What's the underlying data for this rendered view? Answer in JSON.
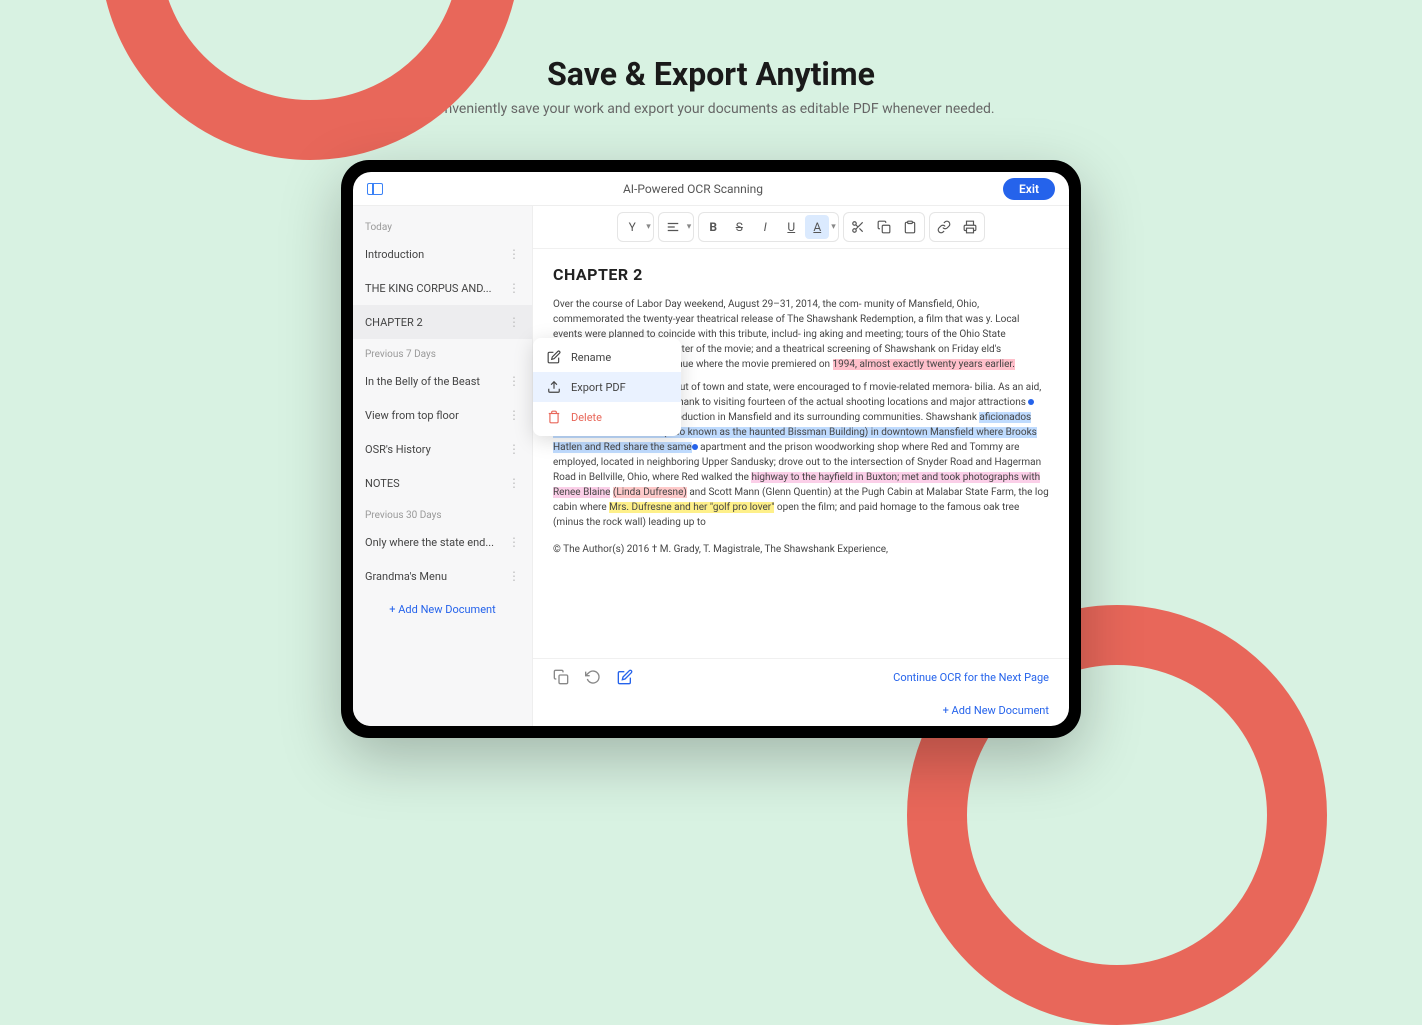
{
  "hero": {
    "title": "Save & Export Anytime",
    "subtitle": "Conveniently save your work and export your documents as editable PDF whenever needed."
  },
  "topbar": {
    "title": "AI-Powered OCR Scanning",
    "exit": "Exit"
  },
  "sidebar": {
    "sections": [
      {
        "label": "Today",
        "items": [
          {
            "title": "Introduction",
            "active": false
          },
          {
            "title": "THE KING CORPUS AND...",
            "active": false
          },
          {
            "title": "CHAPTER 2",
            "active": true
          }
        ]
      },
      {
        "label": "Previous 7 Days",
        "items": [
          {
            "title": "In the Belly of the Beast",
            "active": false
          },
          {
            "title": "View from top floor",
            "active": false
          },
          {
            "title": "OSR's History",
            "active": false
          },
          {
            "title": "NOTES",
            "active": false
          }
        ]
      },
      {
        "label": "Previous 30 Days",
        "items": [
          {
            "title": "Only where the state end...",
            "active": false
          },
          {
            "title": "Grandma's Menu",
            "active": false
          }
        ]
      }
    ],
    "add_doc": "+ Add New Document"
  },
  "context_menu": {
    "rename": "Rename",
    "export": "Export PDF",
    "delete": "Delete"
  },
  "content": {
    "heading": "CHAPTER 2",
    "p1_a": "Over the course of Labor Day weekend, August 29–31, 2014, the com- munity of Mansfield, Ohio, commemorated the twenty-year theatrical release of The Shawshank Redemption, a film that was",
    "p1_b": "y. Local events were planned to coincide with this tribute, includ- ing",
    "p1_c": "aking and meeting; tours of the Ohio State Reformatory (OSR), the",
    "p1_d": "e center of the movie; and a theatrical screening of Shawshank on Friday",
    "p1_e": "eld's Renaissance Theatre, the venue where the movie premiered on",
    "hl_pink": "1994, almost exactly twenty years earlier.",
    "p2_a": "d and those travelling from out of town and state, were encouraged to",
    "p2_b": "f movie-related memora- bilia. As an aid, they made use of the Shawshank",
    "p2_c": "to visiting fourteen of the actual shooting locations and major attractions",
    "p2_d": "associated with the film's production in Mansfield and its surrounding communities. Shawshank ",
    "hl_blue": "aficionados toured the Bisman Hotel (also known as the haunted Bissman Building) in downtown Mansfield where Brooks Hatlen and Red share the same",
    "p2_e": " apartment and the prison woodworking shop where Red and Tommy are employed, located in neighboring Upper Sandusky; drove out to the intersection of Snyder Road and Hagerman Road in Bellville, Ohio, where Red walked the ",
    "hl_magenta": "highway to the hayfield in Buxton; met and took photographs with Renee Blaine",
    "hl_red": "(Linda Dufresne)",
    "p2_f": " and Scott Mann (Glenn Quentin) at the Pugh Cabin at Malabar State Farm, the log cabin where ",
    "hl_yellow": "Mrs. Dufresne and her \"golf pro lover\"",
    "p2_g": " open the film; and paid homage to the famous oak tree (minus the rock wall) leading up to",
    "copyright": "© The Author(s) 2016 † M. Grady, T. Magistrale, The Shawshank Experience,"
  },
  "footer": {
    "continue": "Continue OCR for the Next Page",
    "add_doc": "+ Add New Document"
  }
}
